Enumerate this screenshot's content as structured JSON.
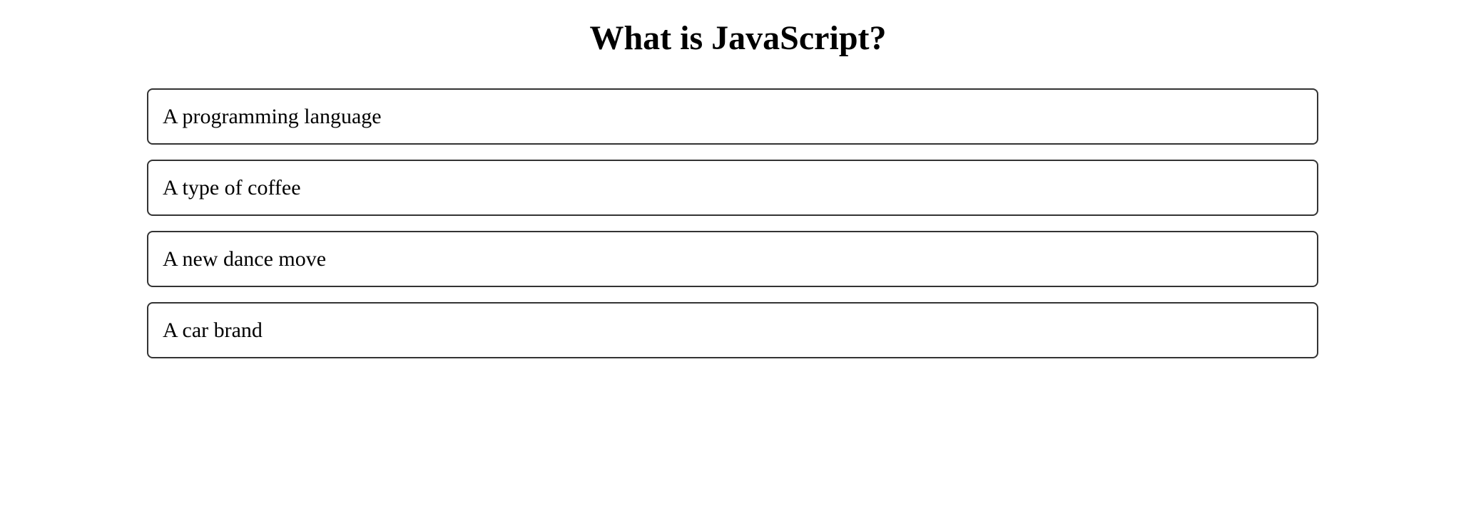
{
  "quiz": {
    "question": "What is JavaScript?",
    "options": [
      {
        "label": "A programming language"
      },
      {
        "label": "A type of coffee"
      },
      {
        "label": "A new dance move"
      },
      {
        "label": "A car brand"
      }
    ]
  }
}
